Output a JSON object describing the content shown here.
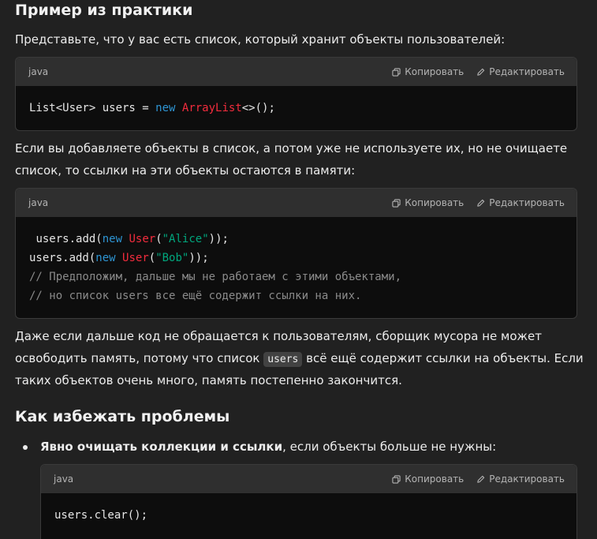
{
  "section1": {
    "heading": "Пример из практики",
    "intro": "Представьте, что у вас есть список, который хранит объекты пользователей:"
  },
  "code_common": {
    "copy_label": "Копировать",
    "edit_label": "Редактировать"
  },
  "code1": {
    "lang": "java",
    "line1": {
      "a": "List<User> users = ",
      "kw": "new",
      "sp": " ",
      "cls": "ArrayList",
      "b": "<>();"
    }
  },
  "para2": {
    "line1": "Если вы добавляете объекты в список, а потом уже не используете их, но не очищаете",
    "line2": "список, то ссылки на эти объекты остаются в памяти:"
  },
  "code2": {
    "lang": "java",
    "line1": {
      "a": "users.add(",
      "kw": "new",
      "sp": " ",
      "cls": "User",
      "p": "(",
      "str": "\"Alice\"",
      "b": "));"
    },
    "line2": {
      "a": "users.add(",
      "kw": "new",
      "sp": " ",
      "cls": "User",
      "p": "(",
      "str": "\"Bob\"",
      "b": "));"
    },
    "line3": "// Предположим, дальше мы не работаем с этими объектами,",
    "line4": "// но список users все ещё содержит ссылки на них."
  },
  "para3": {
    "line1": "Даже если дальше код не обращается к пользователям, сборщик мусора не может",
    "line2_pre": "освободить память, потому что список ",
    "line2_code": "users",
    "line2_post": " всё ещё содержит ссылки на объекты. Если",
    "line3": "таких объектов очень много, память постепенно закончится."
  },
  "section2": {
    "heading": "Как избежать проблемы",
    "bullet1_bold": "Явно очищать коллекции и ссылки",
    "bullet1_rest": ", если объекты больше не нужны:"
  },
  "code3": {
    "lang": "java",
    "line1": "users.clear();"
  }
}
